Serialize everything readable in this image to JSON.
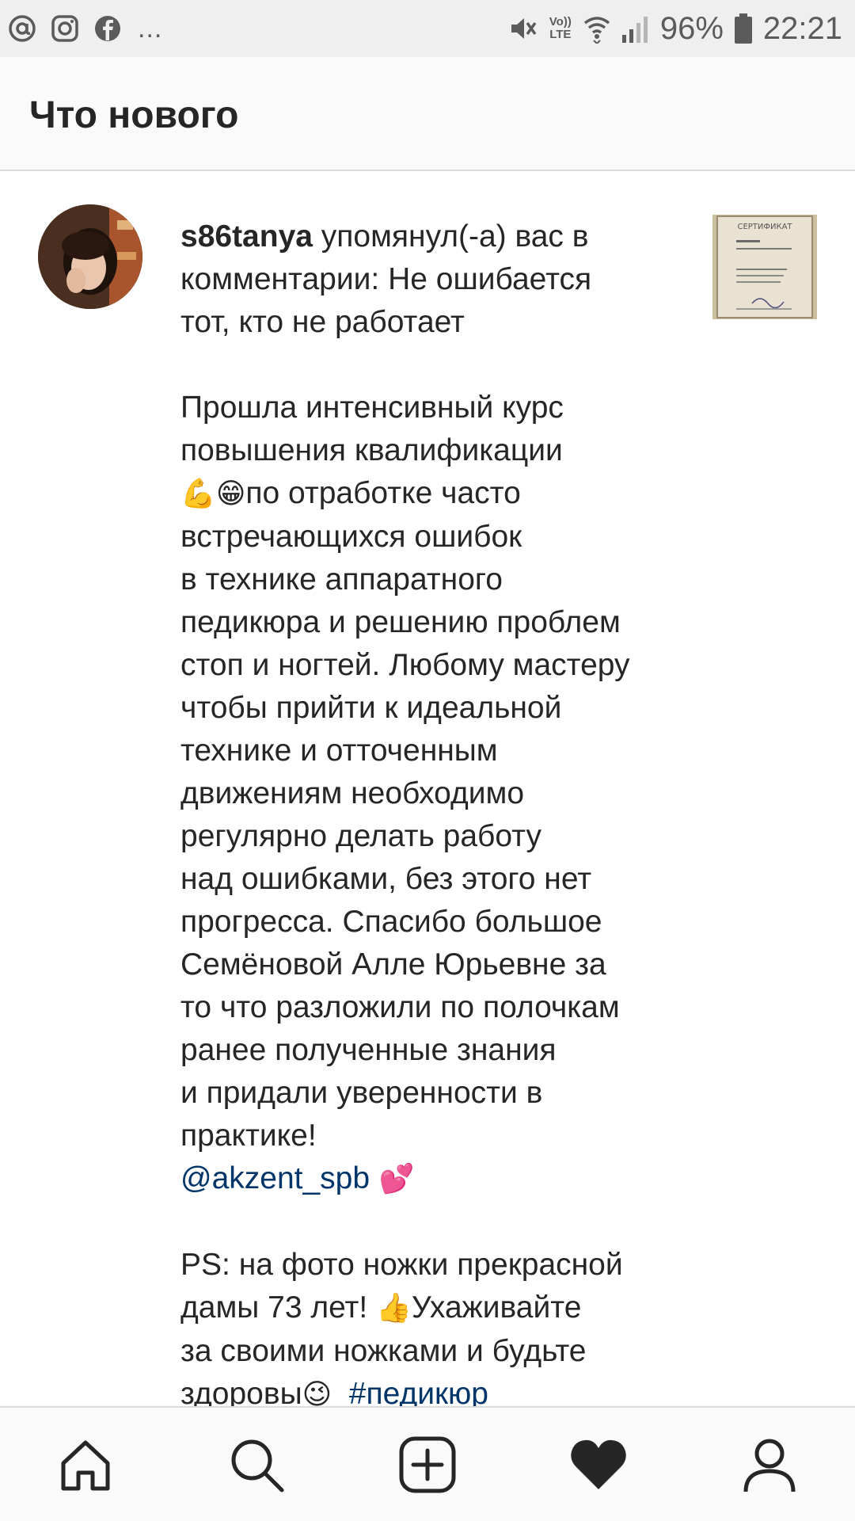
{
  "status_bar": {
    "left_icons": [
      "at-icon",
      "instagram-icon",
      "facebook-icon"
    ],
    "more": "...",
    "lte_top": "Vo))",
    "lte_bottom": "LTE",
    "battery": "96%",
    "time": "22:21"
  },
  "header": {
    "title": "Что нового"
  },
  "notification": {
    "username": "s86tanya",
    "intro": " упомянул(-а) вас в\nкомментарии: Не ошибается\nтот, кто не работает\n\nПрошла интенсивный курс\nповышения квалификации\n",
    "emoji_1": "💪😁",
    "body": "по отработке часто\nвстречающихся ошибок\nв технике аппаратного\nпедикюра и решению проблем\nстоп и ногтей. Любому мастеру\nчтобы прийти к идеальной\nтехнике и отточенным\nдвижениям необходимо\nрегулярно делать работу\nнад ошибками, без этого нет\nпрогресса. Спасибо большое\nСемёновой Алле Юрьевне за\nто что разложили по полочкам\nранее полученные знания\nи придали уверенности в\nпрактике!\n",
    "mention": "@akzent_spb",
    "emoji_2": " 💕",
    "ps_1": "\n\nPS: на фото ножки прекрасной\nдамы 73 лет! ",
    "emoji_3": "👍",
    "ps_2": "Ухаживайте\nза своими ножками и будьте\nздоровы",
    "emoji_4": "😉",
    "hashtag": "  #педикюр",
    "thumbnail_title": "СЕРТИФИКАТ"
  },
  "bottom_nav": {
    "items": [
      "home-icon",
      "search-icon",
      "new-post-icon",
      "activity-heart-icon",
      "profile-icon"
    ]
  }
}
